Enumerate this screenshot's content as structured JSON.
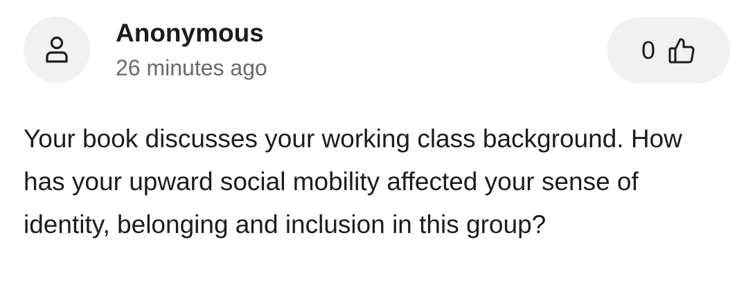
{
  "comment": {
    "author": "Anonymous",
    "timestamp": "26 minutes ago",
    "avatar_icon": "user-icon",
    "vote": {
      "count": "0",
      "icon": "thumbs-up-icon"
    },
    "text": "Your book discusses your working class background. How has your upward social mobility affected your sense of identity, belonging and inclusion in this group?"
  },
  "colors": {
    "background": "#ffffff",
    "pill_background": "#f1f1f1",
    "primary_text": "#1c1c1c",
    "secondary_text": "#6a6a6a"
  }
}
